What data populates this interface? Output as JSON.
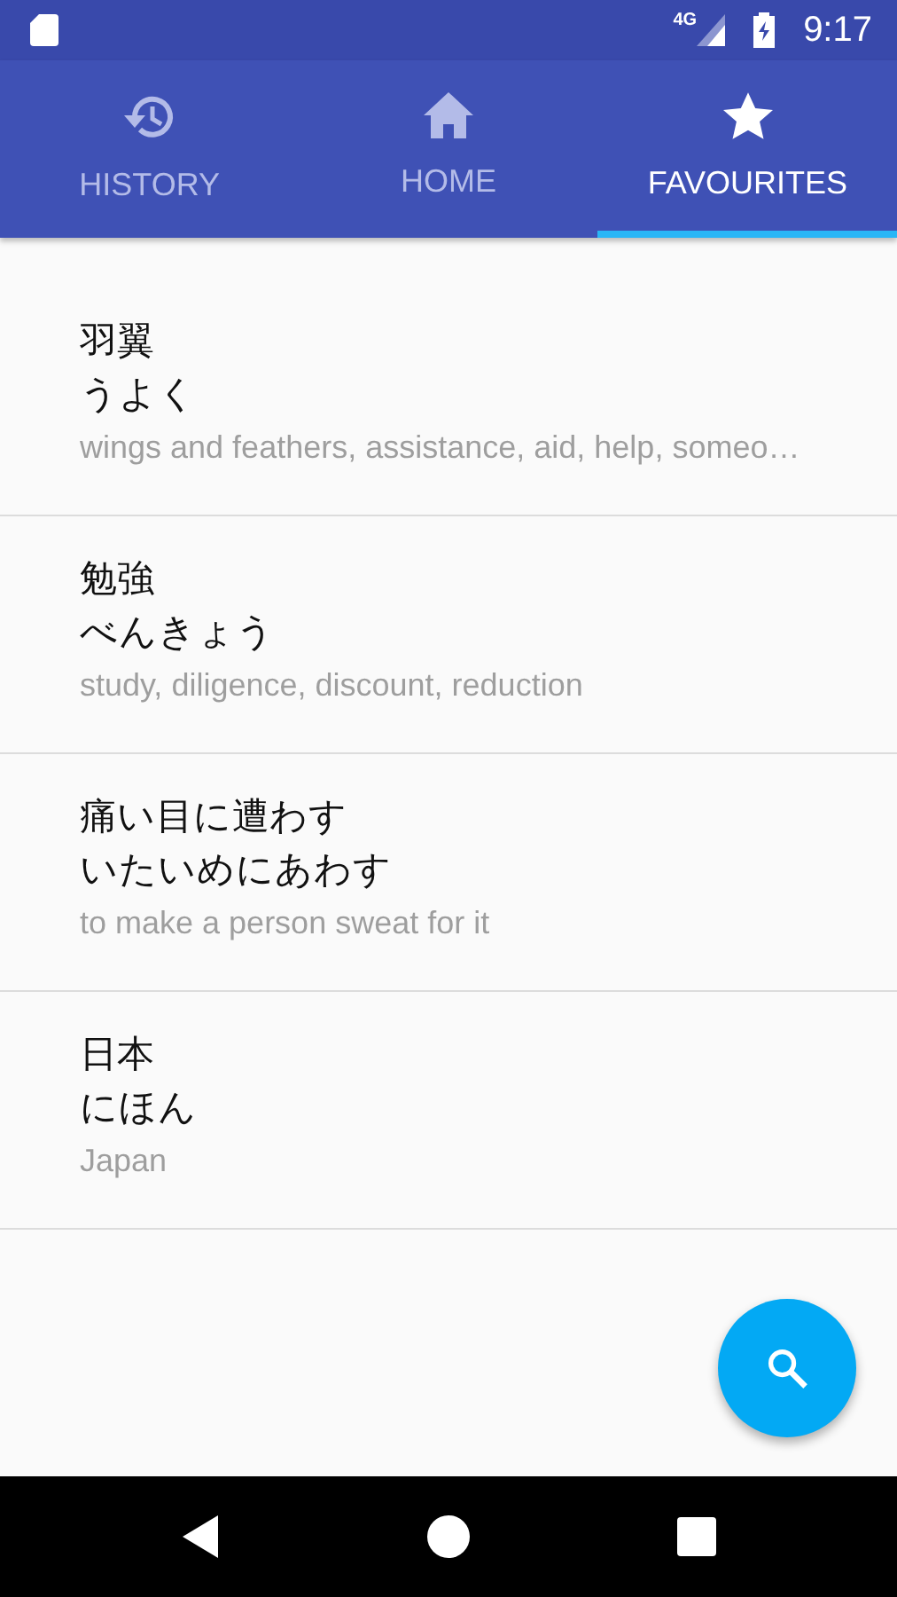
{
  "status_bar": {
    "network": "4G",
    "time": "9:17"
  },
  "tabs": [
    {
      "label": "HISTORY",
      "selected": false
    },
    {
      "label": "HOME",
      "selected": false
    },
    {
      "label": "FAVOURITES",
      "selected": true
    }
  ],
  "favourites": [
    {
      "word": "羽翼",
      "reading": "うよく",
      "meaning": "wings and feathers, assistance, aid, help, someo…"
    },
    {
      "word": "勉強",
      "reading": "べんきょう",
      "meaning": "study, diligence, discount, reduction"
    },
    {
      "word": "痛い目に遭わす",
      "reading": "いたいめにあわす",
      "meaning": "to make a person sweat for it"
    },
    {
      "word": "日本",
      "reading": "にほん",
      "meaning": "Japan"
    }
  ]
}
